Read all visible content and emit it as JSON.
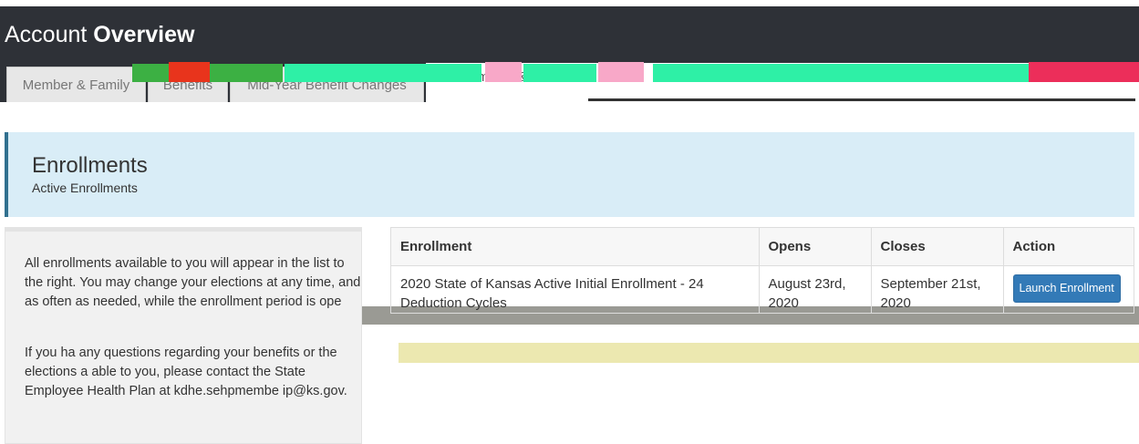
{
  "header": {
    "title_prefix": "Account",
    "title_bold": "Overview"
  },
  "tabs": [
    {
      "label": "Member & Family",
      "active": false
    },
    {
      "label": "Benefits",
      "active": false
    },
    {
      "label": "Mid-Year Benefit Changes",
      "active": false
    },
    {
      "label": "Enrollments & Eve",
      "active": true
    }
  ],
  "page_header": {
    "title": "Enrollments",
    "subtitle": "Active Enrollments"
  },
  "info_panel": {
    "paragraph1": "All enrollments available to you will appear in the list to the right. You may change your elections at any time, and as often as needed, while the enrollment period is ope",
    "paragraph2": "If you ha any questions regarding your benefits or the elections a able to you, please contact the State Employee Health Plan at kdhe.sehpmembe ip@ks.gov."
  },
  "table": {
    "columns": [
      "Enrollment",
      "Opens",
      "Closes",
      "Action"
    ],
    "rows": [
      {
        "enrollment": "2020 State of Kansas Active Initial Enrollment - 24 Deduction Cycles",
        "opens": "August 23rd, 2020",
        "closes": "September 21st, 2020",
        "action": "Launch Enrollment"
      }
    ]
  },
  "colors": {
    "header_bg": "#2e3137",
    "tab_bg": "#e7e7e7",
    "page_header_bg": "#d9edf7",
    "page_header_accent": "#31708f",
    "panel_bg": "#f1f1f1",
    "button_bg": "#337ab7"
  }
}
